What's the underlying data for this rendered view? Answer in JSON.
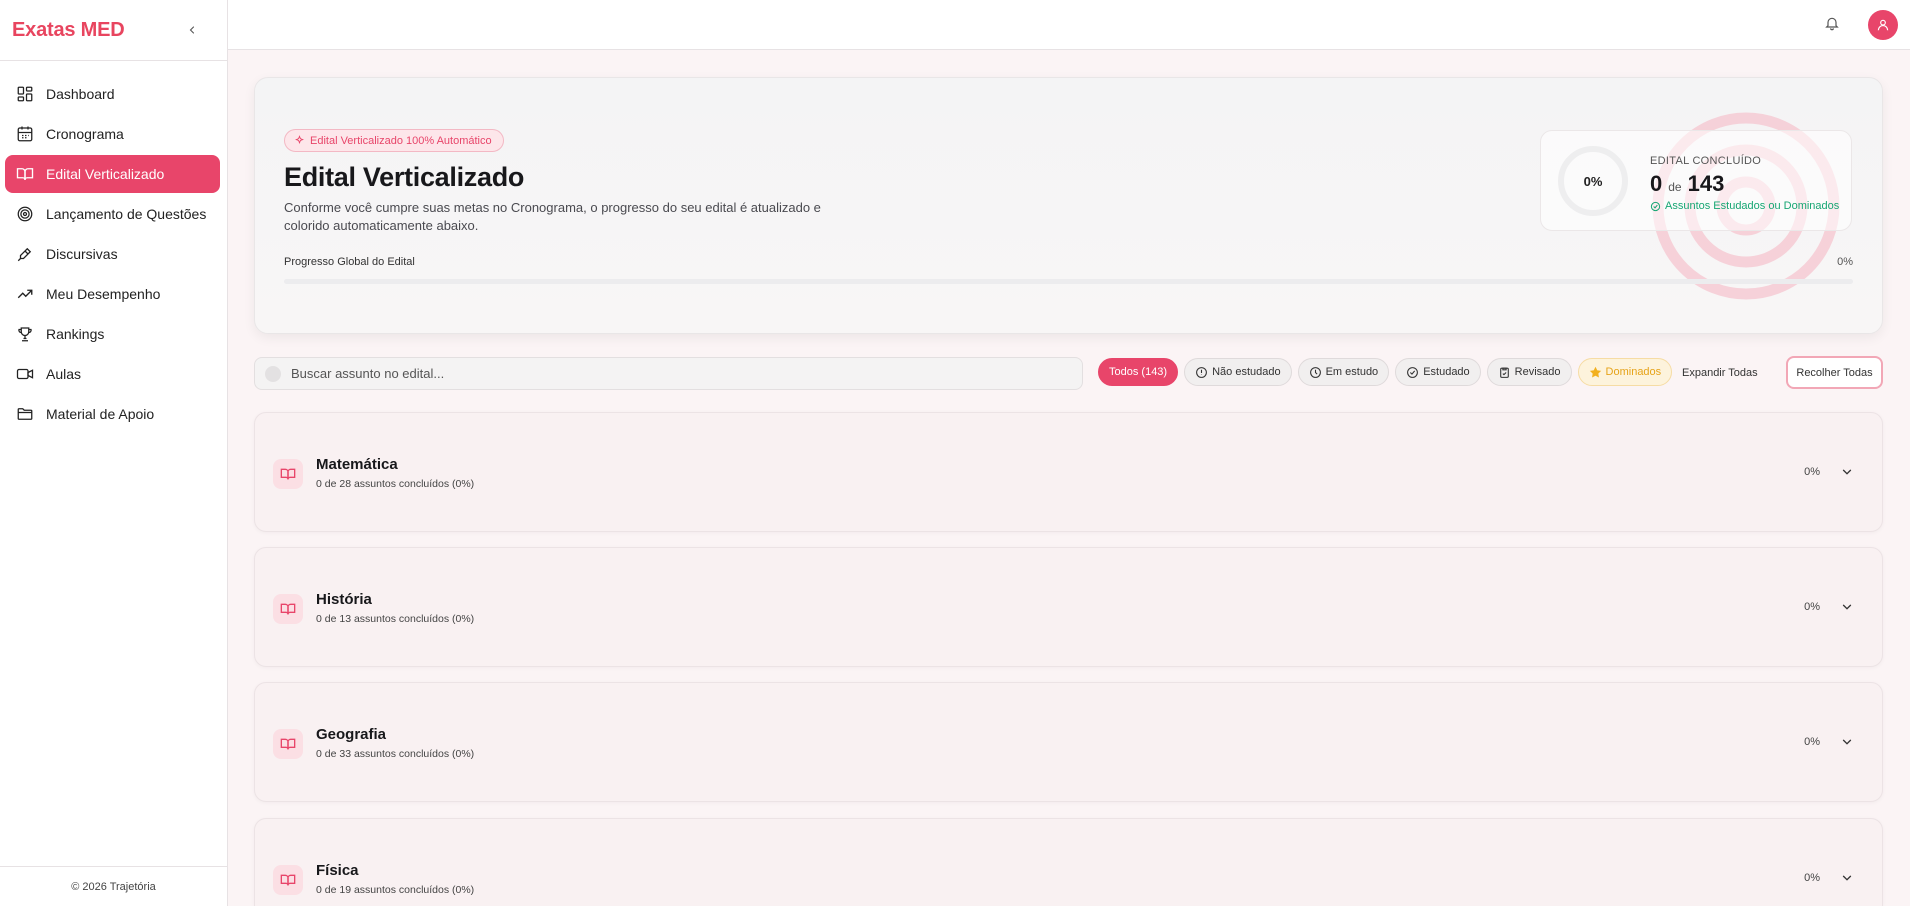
{
  "sidebar": {
    "brand": "Exatas MED",
    "items": [
      {
        "label": "Dashboard",
        "icon": "dashboard-icon"
      },
      {
        "label": "Cronograma",
        "icon": "calendar-icon"
      },
      {
        "label": "Edital Verticalizado",
        "icon": "book-icon",
        "active": true
      },
      {
        "label": "Lançamento de Questões",
        "icon": "target-icon"
      },
      {
        "label": "Discursivas",
        "icon": "pen-icon"
      },
      {
        "label": "Meu Desempenho",
        "icon": "trending-up-icon"
      },
      {
        "label": "Rankings",
        "icon": "trophy-icon"
      },
      {
        "label": "Aulas",
        "icon": "video-icon"
      },
      {
        "label": "Material de Apoio",
        "icon": "folder-icon"
      }
    ],
    "footer": "© 2026 Trajetória"
  },
  "hero": {
    "badge": "Edital Verticalizado 100% Automático",
    "title": "Edital Verticalizado",
    "description": "Conforme você cumpre suas metas no Cronograma, o progresso do seu edital é atualizado e colorido automaticamente abaixo.",
    "progress_label": "Progresso Global do Edital",
    "progress_pct": "0%",
    "progress_value": 0,
    "stat": {
      "ring_pct": "0%",
      "label": "EDITAL CONCLUÍDO",
      "done": "0",
      "de": "de",
      "total": "143",
      "sub": "Assuntos Estudados ou Dominados"
    }
  },
  "search": {
    "placeholder": "Buscar assunto no edital..."
  },
  "filters": [
    {
      "label": "Todos (143)",
      "icon": "",
      "style": "active"
    },
    {
      "label": "Não estudado",
      "icon": "alert-circle-icon",
      "style": ""
    },
    {
      "label": "Em estudo",
      "icon": "clock-icon",
      "style": ""
    },
    {
      "label": "Estudado",
      "icon": "check-circle-icon",
      "style": ""
    },
    {
      "label": "Revisado",
      "icon": "clipboard-check-icon",
      "style": ""
    },
    {
      "label": "Dominados",
      "icon": "star-icon",
      "style": "gold"
    }
  ],
  "actions": {
    "expand": "Expandir Todas",
    "collapse": "Recolher Todas"
  },
  "subjects": [
    {
      "name": "Matemática",
      "sub": "0 de 28 assuntos concluídos (0%)",
      "pct": "0%"
    },
    {
      "name": "História",
      "sub": "0 de 13 assuntos concluídos (0%)",
      "pct": "0%"
    },
    {
      "name": "Geografia",
      "sub": "0 de 33 assuntos concluídos (0%)",
      "pct": "0%"
    },
    {
      "name": "Física",
      "sub": "0 de 19 assuntos concluídos (0%)",
      "pct": "0%"
    }
  ],
  "colors": {
    "accent": "#e8456a",
    "success": "#17a673",
    "gold": "#e6a31a"
  }
}
